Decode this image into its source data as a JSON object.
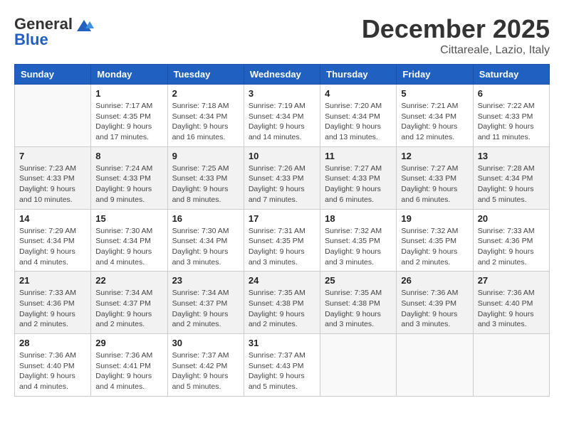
{
  "header": {
    "logo_general": "General",
    "logo_blue": "Blue",
    "month_title": "December 2025",
    "location": "Cittareale, Lazio, Italy"
  },
  "weekdays": [
    "Sunday",
    "Monday",
    "Tuesday",
    "Wednesday",
    "Thursday",
    "Friday",
    "Saturday"
  ],
  "weeks": [
    [
      {
        "day": "",
        "info": ""
      },
      {
        "day": "1",
        "info": "Sunrise: 7:17 AM\nSunset: 4:35 PM\nDaylight: 9 hours\nand 17 minutes."
      },
      {
        "day": "2",
        "info": "Sunrise: 7:18 AM\nSunset: 4:34 PM\nDaylight: 9 hours\nand 16 minutes."
      },
      {
        "day": "3",
        "info": "Sunrise: 7:19 AM\nSunset: 4:34 PM\nDaylight: 9 hours\nand 14 minutes."
      },
      {
        "day": "4",
        "info": "Sunrise: 7:20 AM\nSunset: 4:34 PM\nDaylight: 9 hours\nand 13 minutes."
      },
      {
        "day": "5",
        "info": "Sunrise: 7:21 AM\nSunset: 4:34 PM\nDaylight: 9 hours\nand 12 minutes."
      },
      {
        "day": "6",
        "info": "Sunrise: 7:22 AM\nSunset: 4:33 PM\nDaylight: 9 hours\nand 11 minutes."
      }
    ],
    [
      {
        "day": "7",
        "info": "Sunrise: 7:23 AM\nSunset: 4:33 PM\nDaylight: 9 hours\nand 10 minutes."
      },
      {
        "day": "8",
        "info": "Sunrise: 7:24 AM\nSunset: 4:33 PM\nDaylight: 9 hours\nand 9 minutes."
      },
      {
        "day": "9",
        "info": "Sunrise: 7:25 AM\nSunset: 4:33 PM\nDaylight: 9 hours\nand 8 minutes."
      },
      {
        "day": "10",
        "info": "Sunrise: 7:26 AM\nSunset: 4:33 PM\nDaylight: 9 hours\nand 7 minutes."
      },
      {
        "day": "11",
        "info": "Sunrise: 7:27 AM\nSunset: 4:33 PM\nDaylight: 9 hours\nand 6 minutes."
      },
      {
        "day": "12",
        "info": "Sunrise: 7:27 AM\nSunset: 4:33 PM\nDaylight: 9 hours\nand 6 minutes."
      },
      {
        "day": "13",
        "info": "Sunrise: 7:28 AM\nSunset: 4:34 PM\nDaylight: 9 hours\nand 5 minutes."
      }
    ],
    [
      {
        "day": "14",
        "info": "Sunrise: 7:29 AM\nSunset: 4:34 PM\nDaylight: 9 hours\nand 4 minutes."
      },
      {
        "day": "15",
        "info": "Sunrise: 7:30 AM\nSunset: 4:34 PM\nDaylight: 9 hours\nand 4 minutes."
      },
      {
        "day": "16",
        "info": "Sunrise: 7:30 AM\nSunset: 4:34 PM\nDaylight: 9 hours\nand 3 minutes."
      },
      {
        "day": "17",
        "info": "Sunrise: 7:31 AM\nSunset: 4:35 PM\nDaylight: 9 hours\nand 3 minutes."
      },
      {
        "day": "18",
        "info": "Sunrise: 7:32 AM\nSunset: 4:35 PM\nDaylight: 9 hours\nand 3 minutes."
      },
      {
        "day": "19",
        "info": "Sunrise: 7:32 AM\nSunset: 4:35 PM\nDaylight: 9 hours\nand 2 minutes."
      },
      {
        "day": "20",
        "info": "Sunrise: 7:33 AM\nSunset: 4:36 PM\nDaylight: 9 hours\nand 2 minutes."
      }
    ],
    [
      {
        "day": "21",
        "info": "Sunrise: 7:33 AM\nSunset: 4:36 PM\nDaylight: 9 hours\nand 2 minutes."
      },
      {
        "day": "22",
        "info": "Sunrise: 7:34 AM\nSunset: 4:37 PM\nDaylight: 9 hours\nand 2 minutes."
      },
      {
        "day": "23",
        "info": "Sunrise: 7:34 AM\nSunset: 4:37 PM\nDaylight: 9 hours\nand 2 minutes."
      },
      {
        "day": "24",
        "info": "Sunrise: 7:35 AM\nSunset: 4:38 PM\nDaylight: 9 hours\nand 2 minutes."
      },
      {
        "day": "25",
        "info": "Sunrise: 7:35 AM\nSunset: 4:38 PM\nDaylight: 9 hours\nand 3 minutes."
      },
      {
        "day": "26",
        "info": "Sunrise: 7:36 AM\nSunset: 4:39 PM\nDaylight: 9 hours\nand 3 minutes."
      },
      {
        "day": "27",
        "info": "Sunrise: 7:36 AM\nSunset: 4:40 PM\nDaylight: 9 hours\nand 3 minutes."
      }
    ],
    [
      {
        "day": "28",
        "info": "Sunrise: 7:36 AM\nSunset: 4:40 PM\nDaylight: 9 hours\nand 4 minutes."
      },
      {
        "day": "29",
        "info": "Sunrise: 7:36 AM\nSunset: 4:41 PM\nDaylight: 9 hours\nand 4 minutes."
      },
      {
        "day": "30",
        "info": "Sunrise: 7:37 AM\nSunset: 4:42 PM\nDaylight: 9 hours\nand 5 minutes."
      },
      {
        "day": "31",
        "info": "Sunrise: 7:37 AM\nSunset: 4:43 PM\nDaylight: 9 hours\nand 5 minutes."
      },
      {
        "day": "",
        "info": ""
      },
      {
        "day": "",
        "info": ""
      },
      {
        "day": "",
        "info": ""
      }
    ]
  ]
}
